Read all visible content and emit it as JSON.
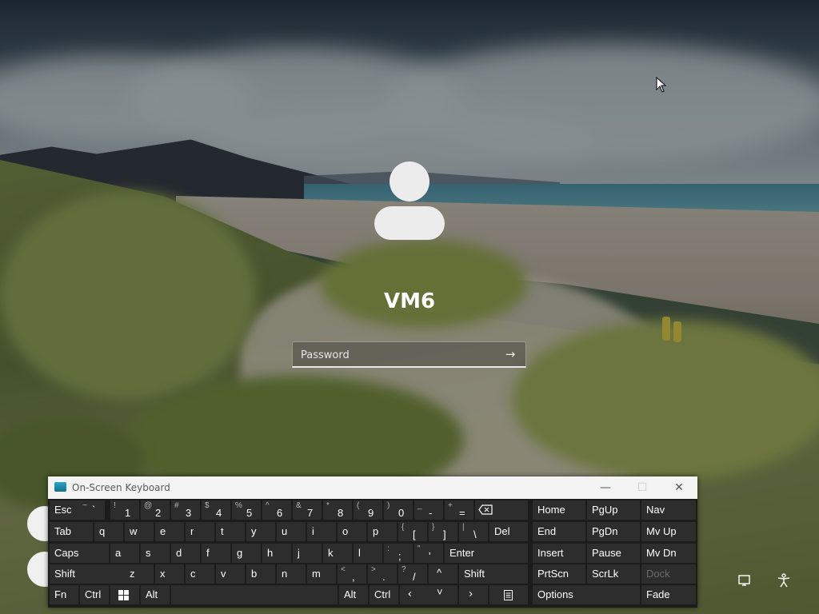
{
  "login": {
    "username": "VM6",
    "password_placeholder": "Password",
    "submit_icon": "arrow-right-icon"
  },
  "osk": {
    "title": "On-Screen Keyboard",
    "window_controls": [
      "minimize-icon",
      "maximize-icon",
      "close-icon"
    ],
    "keys": {
      "esc": "Esc",
      "k1": {
        "shift": "!",
        "main": "1"
      },
      "k2": {
        "shift": "@",
        "main": "2"
      },
      "k3": {
        "shift": "#",
        "main": "3"
      },
      "k4": {
        "shift": "$",
        "main": "4"
      },
      "k5": {
        "shift": "%",
        "main": "5"
      },
      "k6": {
        "shift": "^",
        "main": "6"
      },
      "k7": {
        "shift": "&",
        "main": "7"
      },
      "k8": {
        "shift": "*",
        "main": "8"
      },
      "k9": {
        "shift": "(",
        "main": "9"
      },
      "k0": {
        "shift": ")",
        "main": "0"
      },
      "minus": {
        "shift": "_",
        "main": "-"
      },
      "equals": {
        "shift": "+",
        "main": "="
      },
      "tilde": {
        "shift": "~",
        "main": "`"
      },
      "tab": "Tab",
      "q": "q",
      "w": "w",
      "e": "e",
      "r": "r",
      "t": "t",
      "y": "y",
      "u": "u",
      "i": "i",
      "o": "o",
      "p": "p",
      "lbracket": {
        "shift": "{",
        "main": "["
      },
      "rbracket": {
        "shift": "}",
        "main": "]"
      },
      "backslash": {
        "shift": "|",
        "main": "\\"
      },
      "del": "Del",
      "caps": "Caps",
      "a": "a",
      "s": "s",
      "d": "d",
      "f": "f",
      "g": "g",
      "h": "h",
      "j": "j",
      "k": "k",
      "l": "l",
      "semicolon": {
        "shift": ":",
        "main": ";"
      },
      "quote": {
        "shift": "\"",
        "main": "'"
      },
      "enter": "Enter",
      "shift_left": "Shift",
      "z": "z",
      "x": "x",
      "c": "c",
      "v": "v",
      "b": "b",
      "n": "n",
      "m": "m",
      "comma": {
        "shift": "<",
        "main": ","
      },
      "period": {
        "shift": ">",
        "main": "."
      },
      "slash": {
        "shift": "?",
        "main": "/"
      },
      "shift_right": "Shift",
      "fn": "Fn",
      "ctrl_left": "Ctrl",
      "alt_left": "Alt",
      "alt_right": "Alt",
      "ctrl_right": "Ctrl",
      "home": "Home",
      "pgup": "PgUp",
      "nav": "Nav",
      "end": "End",
      "pgdn": "PgDn",
      "mvup": "Mv Up",
      "insert": "Insert",
      "pause": "Pause",
      "mvdn": "Mv Dn",
      "prtscn": "PrtScn",
      "scrlk": "ScrLk",
      "dock": "Dock",
      "options": "Options",
      "fade": "Fade"
    }
  },
  "corner_icons": [
    "network-icon",
    "accessibility-icon"
  ]
}
